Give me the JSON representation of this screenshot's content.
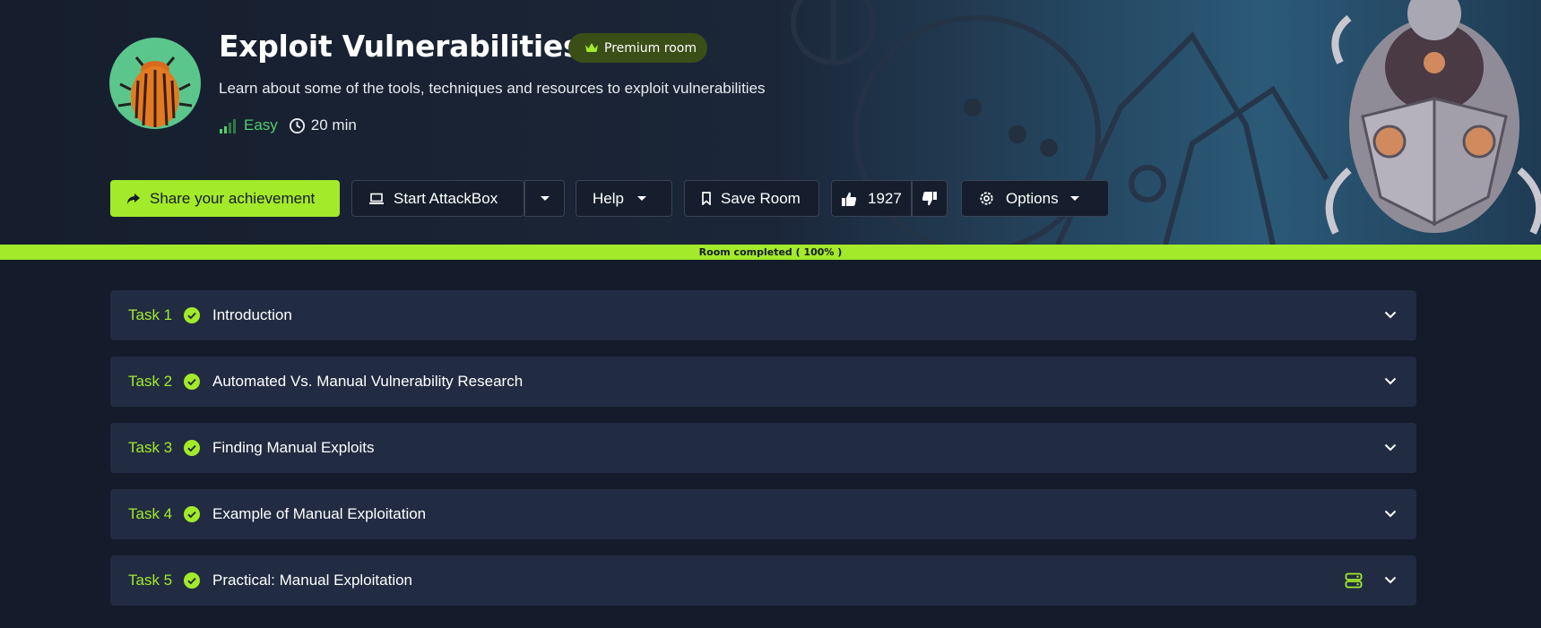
{
  "colors": {
    "accent": "#a3ea2a",
    "background": "#141b2b",
    "panel": "#212c42",
    "difficulty": "#4fcf6b"
  },
  "room": {
    "title": "Exploit Vulnerabilities",
    "badge": "Premium room",
    "description": "Learn about some of the tools, techniques and resources to exploit vulnerabilities",
    "difficulty": "Easy",
    "duration": "20 min"
  },
  "toolbar": {
    "share_label": "Share your achievement",
    "attackbox_label": "Start AttackBox",
    "help_label": "Help",
    "save_label": "Save Room",
    "likes": "1927",
    "options_label": "Options"
  },
  "progress": {
    "label": "Room completed ( 100% )",
    "percent": 100
  },
  "tasks": [
    {
      "number": "Task 1",
      "title": "Introduction",
      "completed": true,
      "has_machine": false
    },
    {
      "number": "Task 2",
      "title": "Automated Vs. Manual Vulnerability Research",
      "completed": true,
      "has_machine": false
    },
    {
      "number": "Task 3",
      "title": "Finding Manual Exploits",
      "completed": true,
      "has_machine": false
    },
    {
      "number": "Task 4",
      "title": "Example of Manual Exploitation",
      "completed": true,
      "has_machine": false
    },
    {
      "number": "Task 5",
      "title": "Practical: Manual Exploitation",
      "completed": true,
      "has_machine": true
    }
  ],
  "icons": {
    "share": "share-icon",
    "laptop": "laptop-icon",
    "chevron": "chevron-down-icon",
    "bookmark": "bookmark-icon",
    "thumbs_up": "thumbs-up-icon",
    "thumbs_down": "thumbs-down-icon",
    "gear": "gear-icon",
    "crown": "crown-icon",
    "signal": "signal-bars-icon",
    "clock": "clock-icon",
    "check": "check-circle-icon",
    "server": "server-icon"
  }
}
